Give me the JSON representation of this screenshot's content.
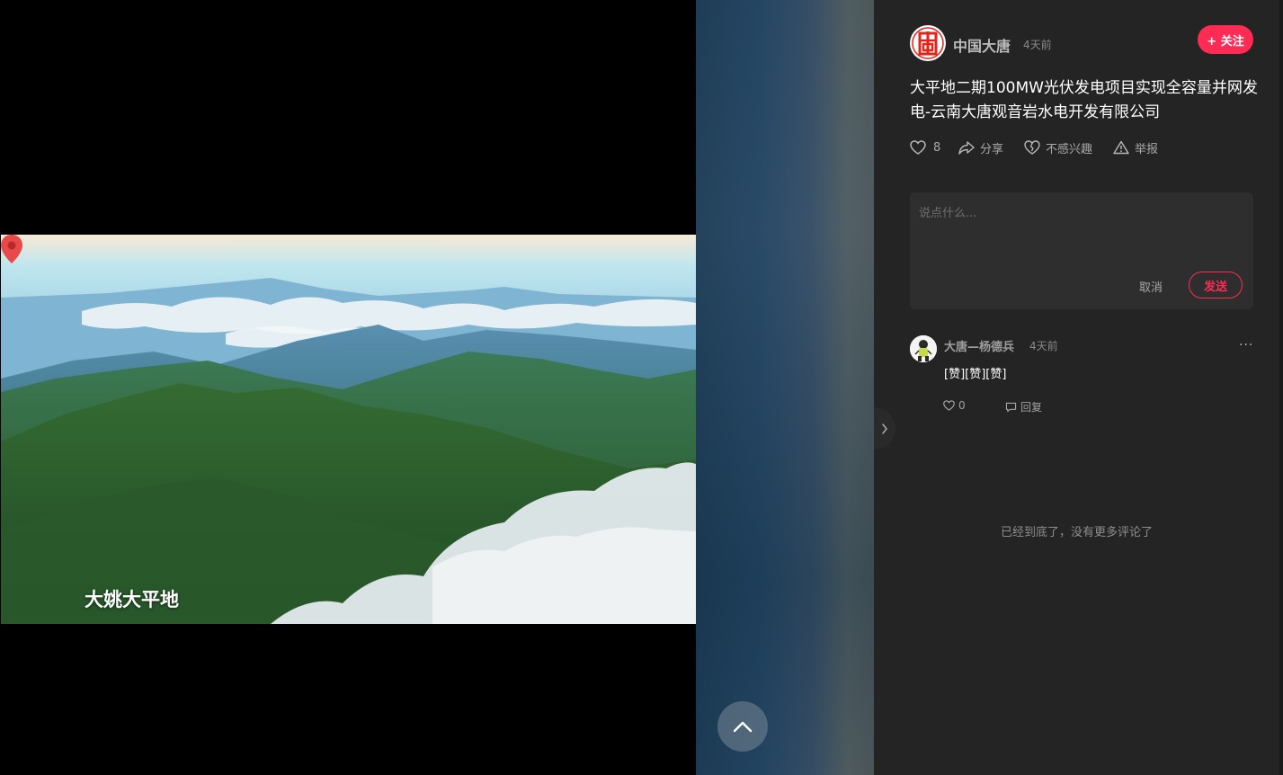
{
  "video": {
    "location_label": "大姚大平地",
    "location_icon": "map-pin-icon"
  },
  "author": {
    "name": "中国大唐",
    "time": "4天前",
    "avatar_icon": "datang-logo-icon",
    "follow_label": "+ 关注"
  },
  "post": {
    "title": "大平地二期100MW光伏发电项目实现全容量并网发电-云南大唐观音岩水电开发有限公司"
  },
  "actions": {
    "like_count": "8",
    "share_label": "分享",
    "not_interested_label": "不感兴趣",
    "report_label": "举报"
  },
  "comment_form": {
    "placeholder": "说点什么...",
    "cancel_label": "取消",
    "send_label": "发送"
  },
  "comments": [
    {
      "user": "大唐—杨德兵",
      "time": "4天前",
      "text": "[赞][赞][赞]",
      "like_count": "0",
      "reply_label": "回复",
      "more_label": "···"
    }
  ],
  "end_text": "已经到底了，没有更多评论了",
  "colors": {
    "accent": "#fe2c55",
    "panel_bg": "#242424",
    "input_bg": "#2e2e2e",
    "logo_red": "#e3241b"
  }
}
